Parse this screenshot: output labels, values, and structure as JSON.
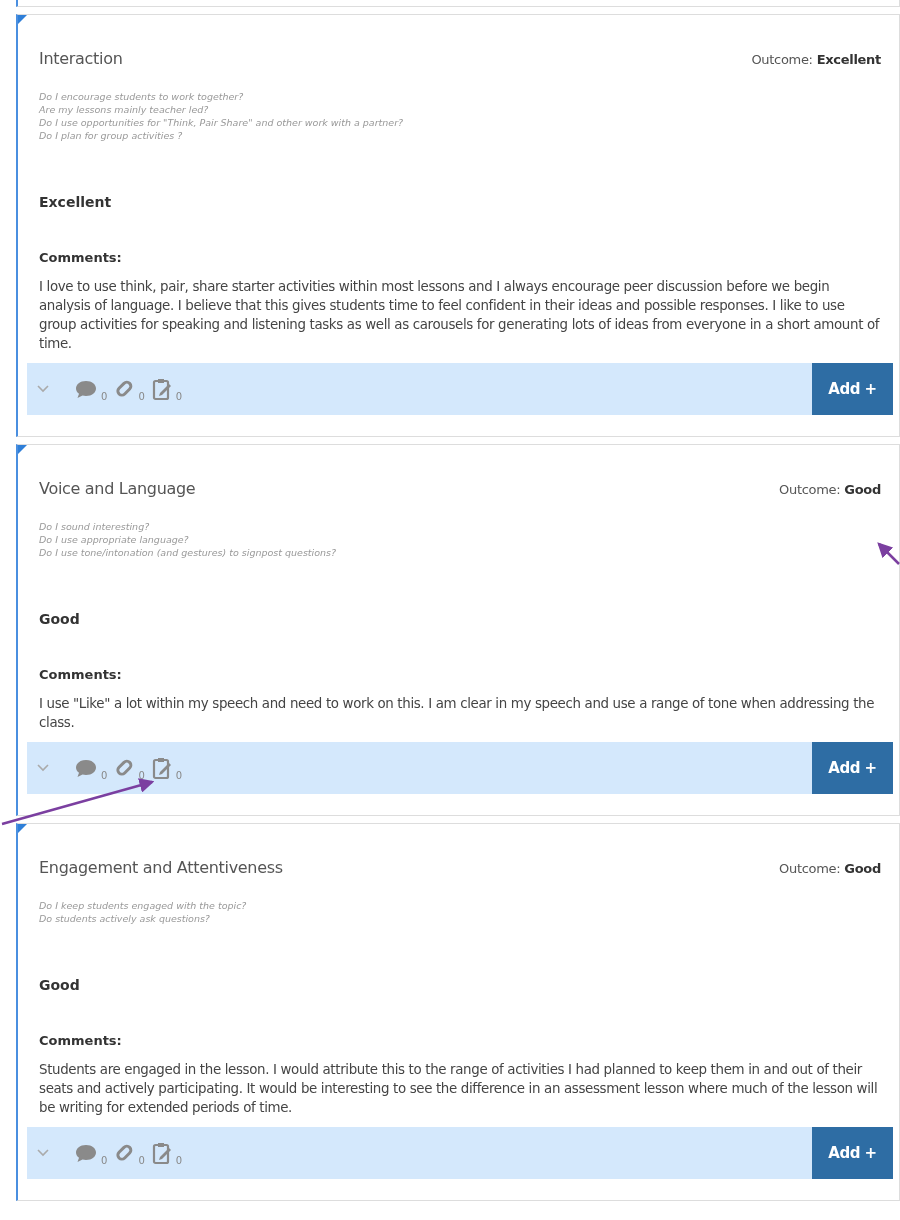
{
  "sections": [
    {
      "title": "Interaction",
      "outcome_label": "Outcome:",
      "outcome": "Excellent",
      "questions": [
        "Do I encourage students to work together?",
        "Are my lessons mainly teacher led?",
        "Do I use opportunities for \"Think, Pair Share\" and other work with a partner?",
        "Do I plan for group activities ?"
      ],
      "rating": "Excellent",
      "comments_label": "Comments:",
      "comments": "I love to use think, pair, share starter activities within most lessons and I always encourage peer discussion before we begin analysis of language. I believe that this gives students time to feel confident in their ideas and possible responses. I like to use group activities for speaking and listening tasks as well as carousels for generating lots of ideas from everyone in a short amount of time.",
      "comment_count": "0",
      "attachment_count": "0",
      "note_count": "0",
      "add_button": "Add +"
    },
    {
      "title": "Voice and Language",
      "outcome_label": "Outcome:",
      "outcome": "Good",
      "questions": [
        "Do I sound interesting?",
        "Do I use appropriate language?",
        "Do I use tone/intonation (and gestures) to signpost questions?"
      ],
      "rating": "Good",
      "comments_label": "Comments:",
      "comments": "I use \"Like\" a lot within my speech and need to work on this. I am clear in my speech and use a range of tone when addressing the class.",
      "comment_count": "0",
      "attachment_count": "0",
      "note_count": "0",
      "add_button": "Add +"
    },
    {
      "title": "Engagement and Attentiveness",
      "outcome_label": "Outcome:",
      "outcome": "Good",
      "questions": [
        "Do I keep students engaged with the topic?",
        "Do students actively ask questions?"
      ],
      "rating": "Good",
      "comments_label": "Comments:",
      "comments": "Students are engaged in the lesson. I would attribute this to the range of activities I had planned to keep them in and out of their seats and actively participating. It would be interesting to see the difference in an assessment lesson where much of the lesson will be writing for extended periods of time.",
      "comment_count": "0",
      "attachment_count": "0",
      "note_count": "0",
      "add_button": "Add +"
    }
  ]
}
